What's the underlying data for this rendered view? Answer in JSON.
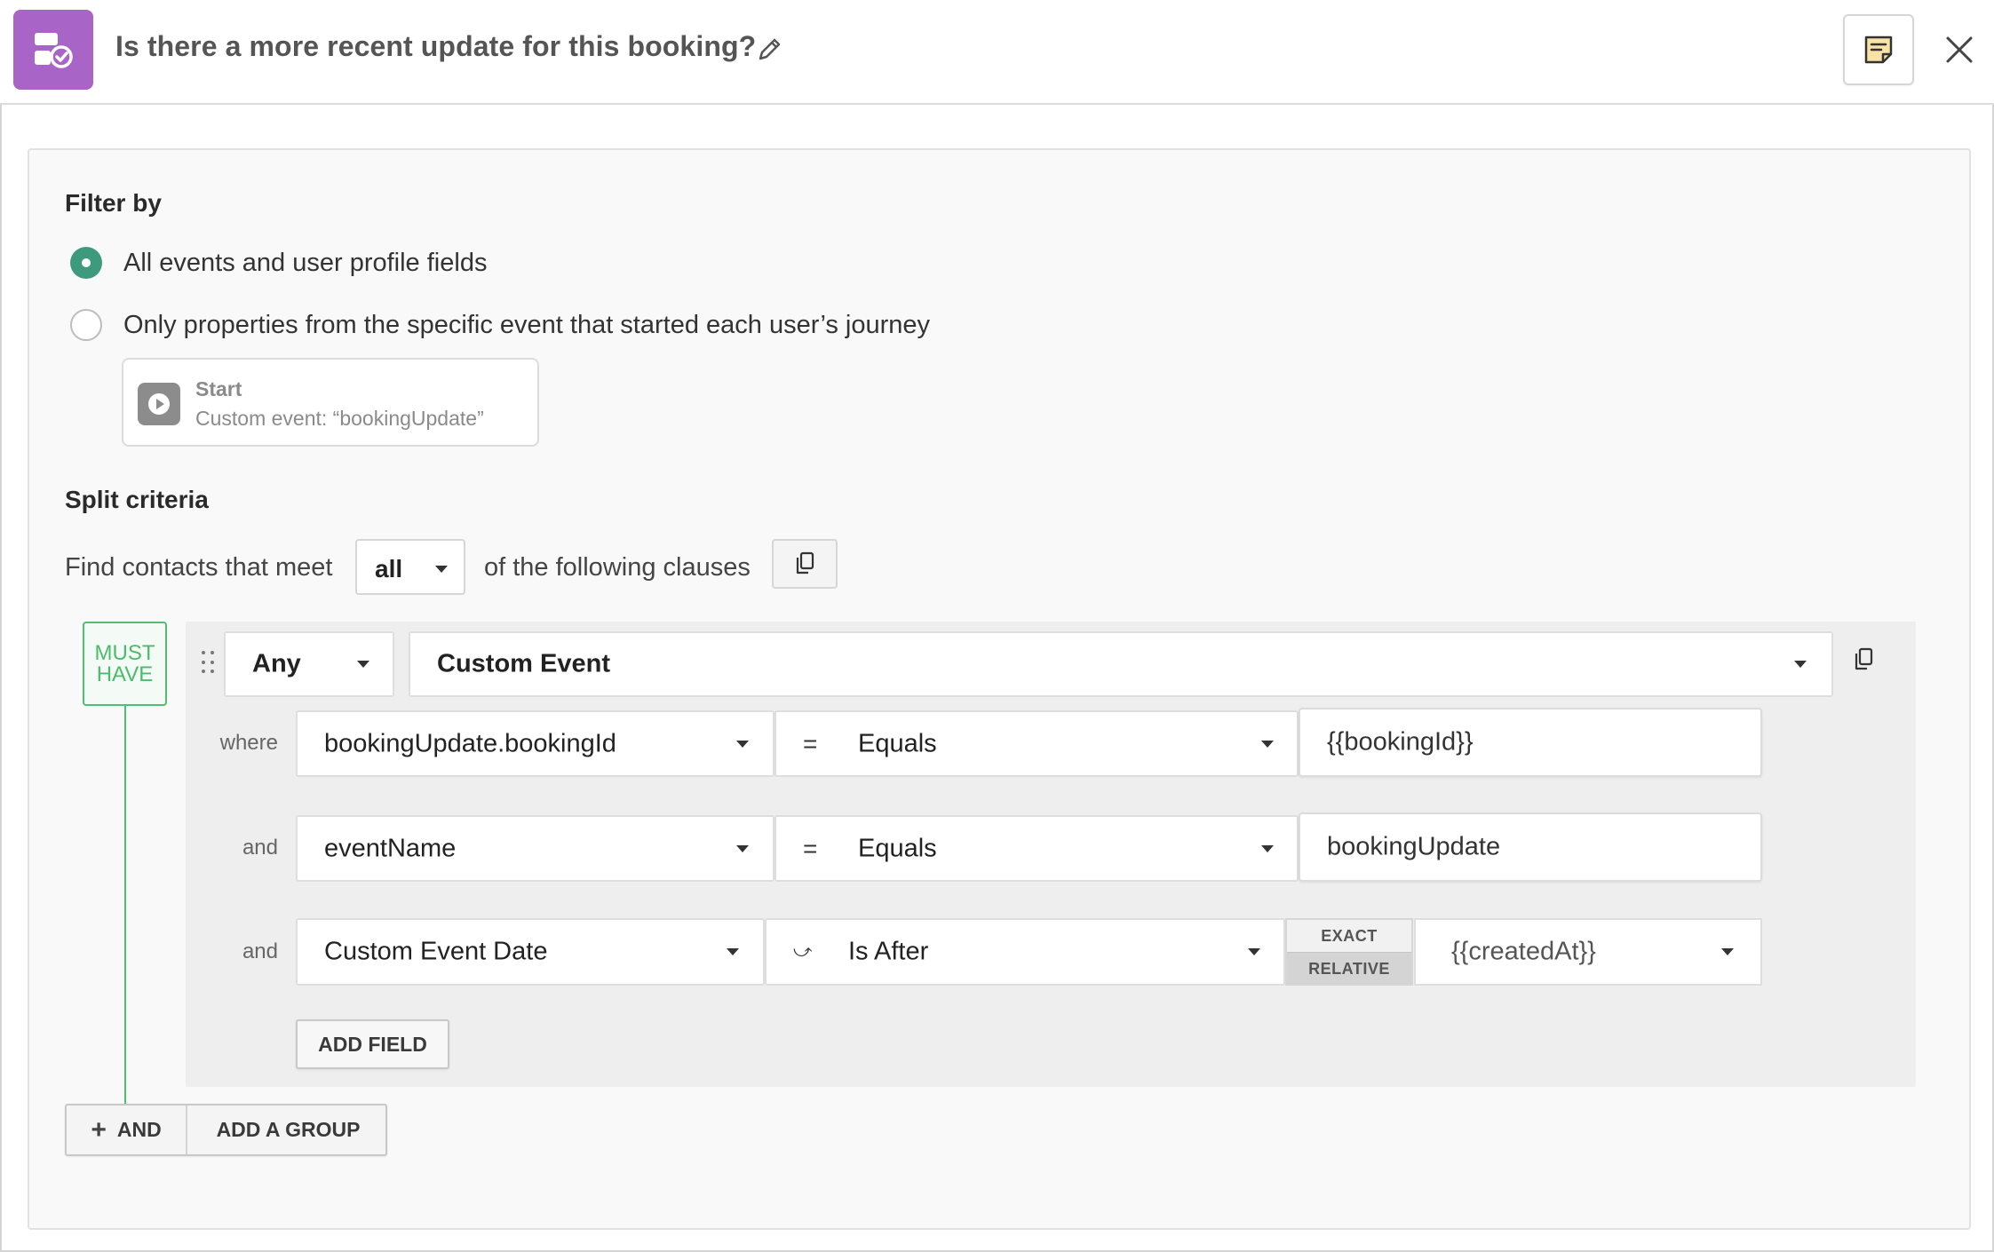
{
  "header": {
    "title": "Is there a more recent update for this booking?",
    "accent_color": "#a864c6",
    "icons": {
      "app": "split-check-icon",
      "edit": "pencil-icon",
      "notes": "note-icon",
      "close": "close-icon"
    }
  },
  "filter": {
    "label": "Filter by",
    "options": [
      {
        "label": "All events and user profile fields",
        "selected": true
      },
      {
        "label": "Only properties from the specific event that started each user’s journey",
        "selected": false
      }
    ],
    "start_card": {
      "title": "Start",
      "subtitle": "Custom event: “bookingUpdate”"
    }
  },
  "split": {
    "label": "Split criteria",
    "find_prefix": "Find contacts that meet",
    "match_value": "all",
    "find_suffix": "of the following clauses"
  },
  "group": {
    "badge_line1": "MUST",
    "badge_line2": "HAVE",
    "quantifier": "Any",
    "event_type": "Custom Event",
    "rows": [
      {
        "connector": "where",
        "field": "bookingUpdate.bookingId",
        "op_symbol": "=",
        "op": "Equals",
        "value": "{{bookingId}}"
      },
      {
        "connector": "and",
        "field": "eventName",
        "op_symbol": "=",
        "op": "Equals",
        "value": "bookingUpdate"
      },
      {
        "connector": "and",
        "field": "Custom Event Date",
        "op_symbol": "⤻",
        "op": "Is After",
        "mode_exact": "EXACT",
        "mode_relative": "RELATIVE",
        "value": "{{createdAt}}"
      }
    ],
    "add_field": "ADD FIELD"
  },
  "footer": {
    "and_label": "AND",
    "add_group_label": "ADD A GROUP"
  },
  "colors": {
    "selected_radio": "#3e9a7c",
    "must_have": "#4cbb6c"
  }
}
